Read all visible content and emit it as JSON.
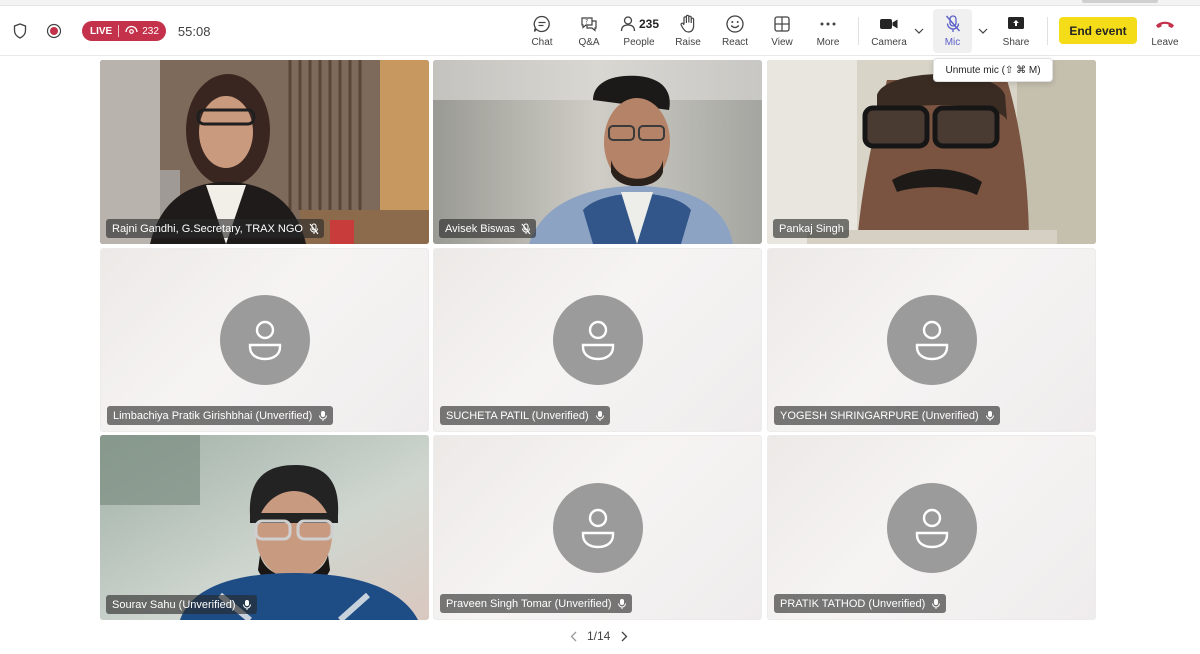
{
  "status": {
    "live_label": "LIVE",
    "viewer_count": "232",
    "timer": "55:08"
  },
  "toolbar": {
    "chat": "Chat",
    "qa": "Q&A",
    "people_label": "People",
    "people_count": "235",
    "raise": "Raise",
    "react": "React",
    "view": "View",
    "more": "More",
    "camera": "Camera",
    "mic": "Mic",
    "share": "Share",
    "end_event": "End event",
    "leave": "Leave"
  },
  "tooltip": "Unmute mic (⇧ ⌘ M)",
  "participants": [
    {
      "name": "Rajni Gandhi, G.Secretary, TRAX NGO"
    },
    {
      "name": "Avisek Biswas"
    },
    {
      "name": "Pankaj Singh"
    },
    {
      "name": "Limbachiya Pratik Girishbhai (Unverified)"
    },
    {
      "name": "SUCHETA PATIL (Unverified)"
    },
    {
      "name": "YOGESH SHRINGARPURE (Unverified)"
    },
    {
      "name": "Sourav Sahu (Unverified)"
    },
    {
      "name": "Praveen Singh Tomar (Unverified)"
    },
    {
      "name": "PRATIK TATHOD (Unverified)"
    }
  ],
  "pager": {
    "text": "1/14"
  },
  "colors": {
    "live": "#c4314b",
    "end_event": "#f5dc18",
    "accent": "#6264a7",
    "leave": "#c4314b"
  }
}
